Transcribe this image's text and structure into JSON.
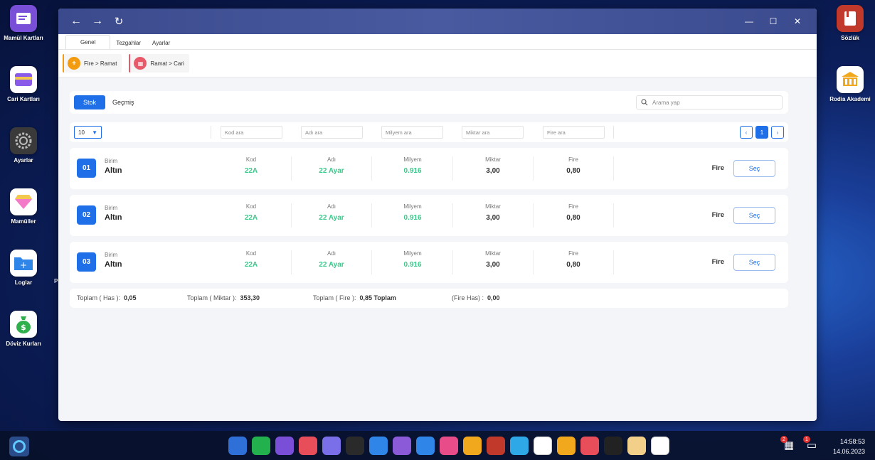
{
  "desktop": {
    "left_icons": [
      {
        "label": "Mamül Kartları",
        "icon": "window-icon",
        "color": "#7a4fd8"
      },
      {
        "label": "Cari Kartları",
        "icon": "card-icon",
        "color": "#5c5fd8"
      },
      {
        "label": "Ayarlar",
        "icon": "gear-icon",
        "color": "#333333"
      },
      {
        "label": "Mamüller",
        "icon": "diamond-icon",
        "color": "#ffffff"
      },
      {
        "label": "Loglar",
        "icon": "folder-icon",
        "color": "#2f86e8"
      },
      {
        "label": "Döviz Kurları",
        "icon": "money-bag-icon",
        "color": "#ffffff"
      }
    ],
    "right_icons": [
      {
        "label": "Sözlük",
        "icon": "book-icon",
        "color": "#c0392b"
      },
      {
        "label": "Rodia Akademi",
        "icon": "bank-icon",
        "color": "#f2a81d"
      }
    ],
    "stray_label": "P"
  },
  "window": {
    "nav": {
      "back": "←",
      "forward": "→",
      "refresh": "↻"
    },
    "controls": {
      "minimize": "—",
      "maximize": "☐",
      "close": "✕"
    },
    "menu_tabs": [
      "Genel",
      "Tezgahlar",
      "Ayarlar"
    ],
    "quick_buttons": [
      {
        "label": "Fire > Ramat",
        "icon": "plus-icon",
        "color": "#f39c12"
      },
      {
        "label": "Ramat > Cari",
        "icon": "calendar-icon",
        "color": "#e85a6a"
      }
    ]
  },
  "main": {
    "tabs": {
      "active": "Stok",
      "other": "Geçmiş"
    },
    "search_placeholder": "Arama yap",
    "page_size": "10",
    "filters": [
      "Kod ara",
      "Adı ara",
      "Milyem ara",
      "Miktar ara",
      "Fire ara"
    ],
    "pager": {
      "prev": "‹",
      "current": "1",
      "next": "›"
    },
    "columns": {
      "birim": "Birim",
      "kod": "Kod",
      "adi": "Adı",
      "milyem": "Milyem",
      "miktar": "Miktar",
      "fire": "Fire"
    },
    "rows": [
      {
        "num": "01",
        "birim": "Altın",
        "kod": "22A",
        "adi": "22 Ayar",
        "milyem": "0.916",
        "miktar": "3,00",
        "fire": "0,80",
        "fire_label": "Fire",
        "action": "Seç"
      },
      {
        "num": "02",
        "birim": "Altın",
        "kod": "22A",
        "adi": "22 Ayar",
        "milyem": "0.916",
        "miktar": "3,00",
        "fire": "0,80",
        "fire_label": "Fire",
        "action": "Seç"
      },
      {
        "num": "03",
        "birim": "Altın",
        "kod": "22A",
        "adi": "22 Ayar",
        "milyem": "0.916",
        "miktar": "3,00",
        "fire": "0,80",
        "fire_label": "Fire",
        "action": "Seç"
      }
    ],
    "totals": {
      "has_label": "Toplam ( Has ):",
      "has_value": "0,05",
      "miktar_label": "Toplam ( Miktar ):",
      "miktar_value": "353,30",
      "fire_label": "Toplam ( Fire ):",
      "fire_value": "0,85 Toplam",
      "firehas_label": "(Fire Has) :",
      "firehas_value": "0,00"
    }
  },
  "taskbar": {
    "dock_colors": [
      "#2f6fd8",
      "#22b14c",
      "#7a4fd8",
      "#e84d5a",
      "#7a6fe8",
      "#2a2a2a",
      "#2f86e8",
      "#8a5ad8",
      "#2f86e8",
      "#e84d8a",
      "#f2a81d",
      "#c0392b",
      "#2fa8e8",
      "#ffffff",
      "#f2a81d",
      "#e84d5a",
      "#222222",
      "#f2d08a",
      "#ffffff"
    ],
    "calendar_badge": "2",
    "chat_badge": "1",
    "time": "14:58:53",
    "date": "14.06.2023"
  }
}
